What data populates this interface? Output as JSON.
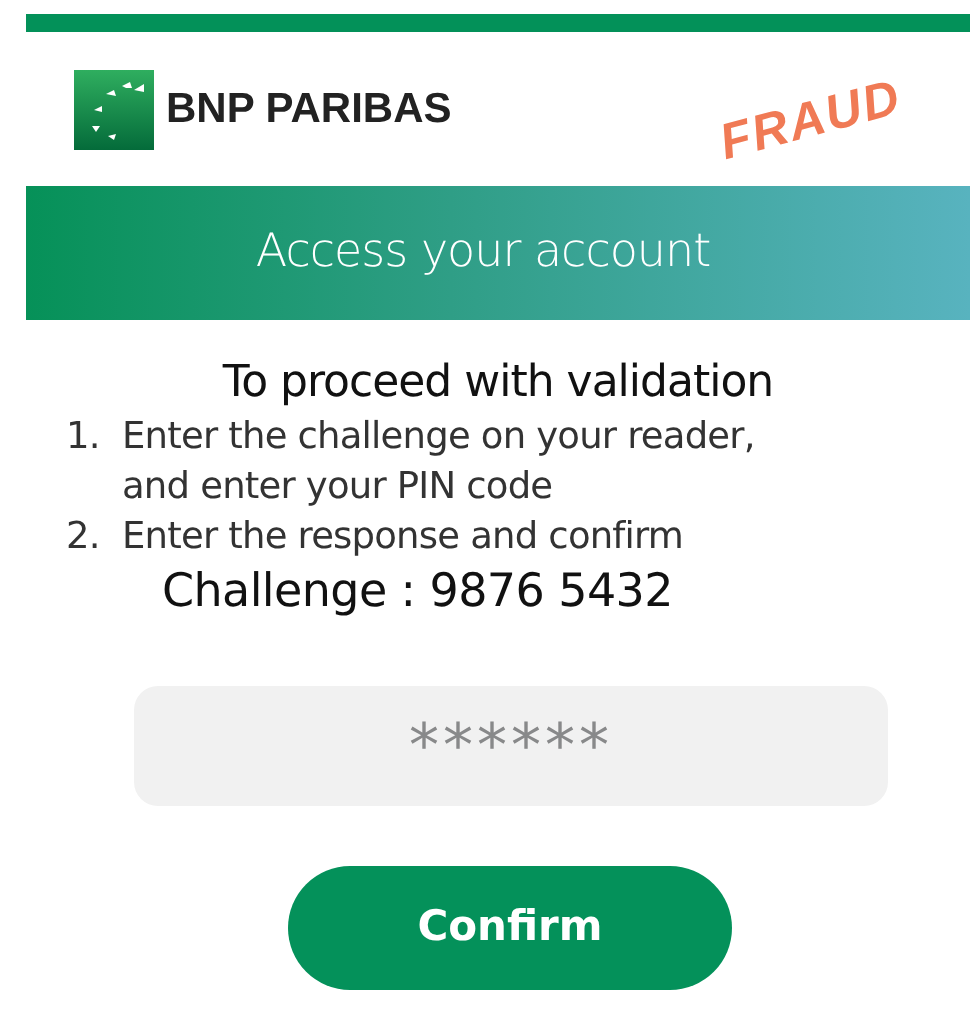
{
  "header": {
    "brand": "BNP PARIBAS",
    "stamp": "FRAUD"
  },
  "banner": {
    "title": "Access your account"
  },
  "instructions": {
    "heading": "To proceed with validation",
    "steps": [
      {
        "number": "1.",
        "text": "Enter the challenge on your reader, and enter your PIN code"
      },
      {
        "number": "2.",
        "text": "Enter the response and confirm"
      }
    ],
    "challenge": "Challenge : 9876 5432"
  },
  "response_field": {
    "placeholder": "******"
  },
  "buttons": [
    {
      "label": "Confirm"
    }
  ]
}
